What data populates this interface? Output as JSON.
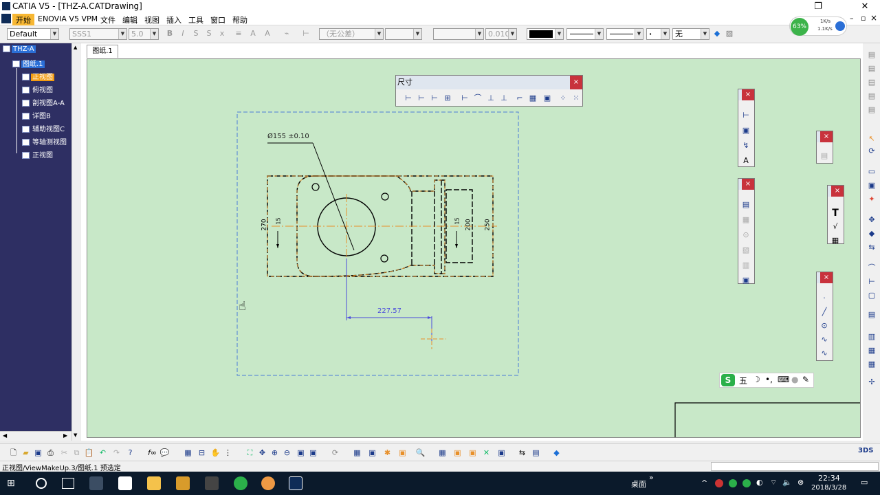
{
  "window": {
    "title": "CATIA V5 - [THZ-A.CATDrawing]",
    "restore_glyph": "❐",
    "close_glyph": "✕",
    "child_min": "–",
    "child_restore": "▫",
    "child_close": "×"
  },
  "menu": [
    "开始",
    "ENOVIA V5 VPM",
    "文件",
    "编辑",
    "视图",
    "插入",
    "工具",
    "窗口",
    "帮助"
  ],
  "toolbar": {
    "style_combo": "Default",
    "font_combo": "SSS1",
    "size_combo": "5.0",
    "tolerance_combo": "（无公差）",
    "precision_combo": "0.010",
    "fill_combo": "无"
  },
  "network": {
    "percent": "63%",
    "up": "1K/s",
    "down": "1.1K/s"
  },
  "tree": {
    "root": "THZ-A",
    "sheet": "图纸.1",
    "views": [
      "正视图",
      "俯视图",
      "剖视图A-A",
      "详图B",
      "辅助视图C",
      "等轴测视图",
      "正视图"
    ]
  },
  "sheet_tab": "图纸.1",
  "dimension_toolbar": {
    "title": "尺寸"
  },
  "drawing": {
    "diameter_label": "Ø155 ±0.10",
    "dim_227": "227.57",
    "dim_left": "270",
    "dim_mid": "200",
    "dim_right": "250",
    "dim_hole_left": "15",
    "dim_hole_right": "15"
  },
  "ime": {
    "mode": "五"
  },
  "statusbar": {
    "text": "正视图/ViewMakeUp.3/图纸.1 预选定"
  },
  "taskbar": {
    "desktop": "桌面",
    "chevron": "»",
    "time": "22:34",
    "date": "2018/3/28"
  },
  "colors": {
    "tree_bg": "#2e2f63",
    "canvas_bg": "#c8e8c8",
    "highlight": "#f39c12",
    "accent_blue": "#2b6fd6"
  }
}
